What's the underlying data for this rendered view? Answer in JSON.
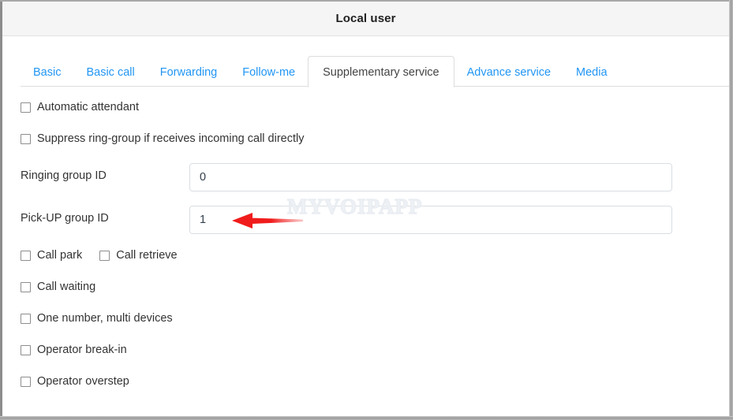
{
  "window": {
    "title": "Local user"
  },
  "tabs": [
    {
      "label": "Basic",
      "active": false
    },
    {
      "label": "Basic call",
      "active": false
    },
    {
      "label": "Forwarding",
      "active": false
    },
    {
      "label": "Follow-me",
      "active": false
    },
    {
      "label": "Supplementary service",
      "active": true
    },
    {
      "label": "Advance service",
      "active": false
    },
    {
      "label": "Media",
      "active": false
    }
  ],
  "form": {
    "checkboxes_top": [
      {
        "label": "Automatic attendant",
        "checked": false
      },
      {
        "label": "Suppress ring-group if receives incoming call directly",
        "checked": false
      }
    ],
    "fields": [
      {
        "label": "Ringing group ID",
        "value": "0",
        "placeholder": ""
      },
      {
        "label": "Pick-UP group ID",
        "value": "1",
        "placeholder": ""
      }
    ],
    "checkboxes_inline": [
      {
        "label": "Call park",
        "checked": false
      },
      {
        "label": "Call retrieve",
        "checked": false
      }
    ],
    "checkboxes_bottom": [
      {
        "label": "Call waiting",
        "checked": false
      },
      {
        "label": "One number, multi devices",
        "checked": false
      },
      {
        "label": "Operator break-in",
        "checked": false
      },
      {
        "label": "Operator overstep",
        "checked": false
      }
    ]
  },
  "watermark": {
    "text": "MYVOIPAPP"
  },
  "annotation": {
    "arrow": "left-pointing-red-arrow",
    "color": "#f01c1c"
  },
  "colors": {
    "tab_link": "#2196f3",
    "tab_active_text": "#444444",
    "titlebar_bg": "#f5f5f5",
    "input_border": "#d9dee3",
    "arrow_red": "#f01c1c"
  }
}
